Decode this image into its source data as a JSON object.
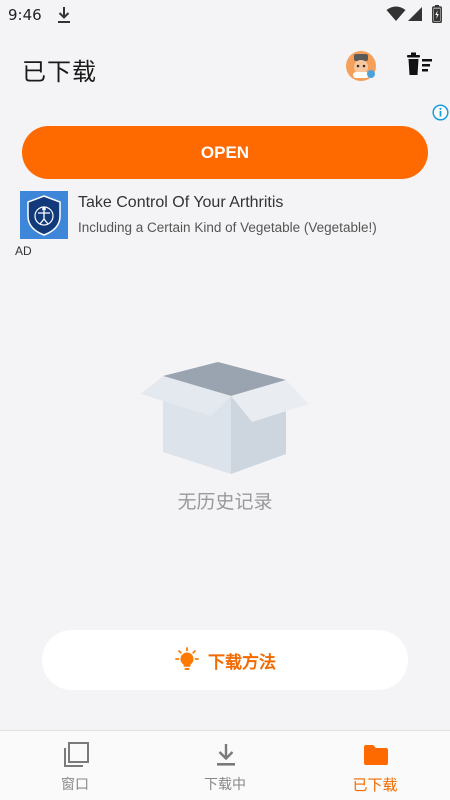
{
  "status_bar": {
    "time": "9:46",
    "icons": [
      "download-icon",
      "wifi-icon",
      "signal-icon",
      "battery-icon"
    ]
  },
  "header": {
    "title": "已下载",
    "icons": [
      "avatar",
      "delete-list-icon"
    ]
  },
  "ad": {
    "button_label": "OPEN",
    "title": "Take Control Of Your Arthritis",
    "subtitle": "Including a Certain Kind of Vegetable (Vegetable!)",
    "label": "AD",
    "icons": [
      "info-icon",
      "ad-logo"
    ]
  },
  "empty_state": {
    "message": "无历史记录",
    "icon": "empty-box-icon"
  },
  "howto": {
    "label": "下载方法",
    "icon": "lightbulb-icon"
  },
  "bottom_nav": {
    "items": [
      {
        "label": "窗口",
        "icon": "windows-icon",
        "active": false
      },
      {
        "label": "下载中",
        "icon": "download-icon",
        "active": false
      },
      {
        "label": "已下载",
        "icon": "folder-icon",
        "active": true
      }
    ]
  },
  "colors": {
    "accent": "#ff6a00",
    "active_nav": "#f26a00",
    "background": "#f4f4f6"
  }
}
